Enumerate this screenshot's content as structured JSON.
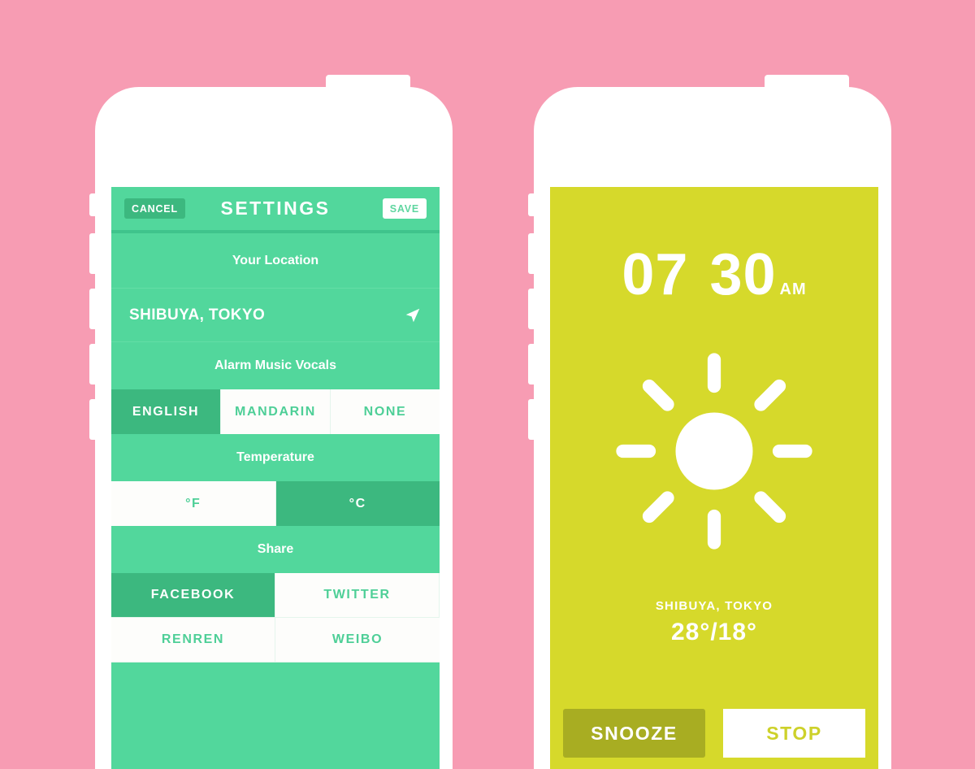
{
  "theme": {
    "background_pink": "#f79cb3",
    "settings_green": "#52d79c",
    "settings_green_dark": "#3cb87f",
    "alarm_yellow": "#d6d92b",
    "alarm_olive": "#a8ad22",
    "white": "#ffffff"
  },
  "settings_screen": {
    "navbar": {
      "cancel_label": "CANCEL",
      "title": "SETTINGS",
      "save_label": "SAVE"
    },
    "location_section": {
      "label": "Your Location",
      "value": "SHIBUYA, TOKYO",
      "icon": "navigation-arrow-icon"
    },
    "vocals_section": {
      "label": "Alarm Music Vocals",
      "options": [
        {
          "label": "ENGLISH",
          "selected": true
        },
        {
          "label": "MANDARIN",
          "selected": false
        },
        {
          "label": "NONE",
          "selected": false
        }
      ]
    },
    "temperature_section": {
      "label": "Temperature",
      "options": [
        {
          "label": "°F",
          "selected": false
        },
        {
          "label": "°C",
          "selected": true
        }
      ]
    },
    "share_section": {
      "label": "Share",
      "options": [
        {
          "label": "FACEBOOK",
          "selected": true
        },
        {
          "label": "TWITTER",
          "selected": false
        },
        {
          "label": "RENREN",
          "selected": false
        },
        {
          "label": "WEIBO",
          "selected": false
        }
      ]
    }
  },
  "alarm_screen": {
    "time": {
      "hours": "07",
      "minutes": "30",
      "meridiem": "AM"
    },
    "weather_icon": "sun-icon",
    "location": "SHIBUYA, TOKYO",
    "temperature": "28°/18°",
    "actions": {
      "snooze_label": "SNOOZE",
      "stop_label": "STOP"
    }
  }
}
